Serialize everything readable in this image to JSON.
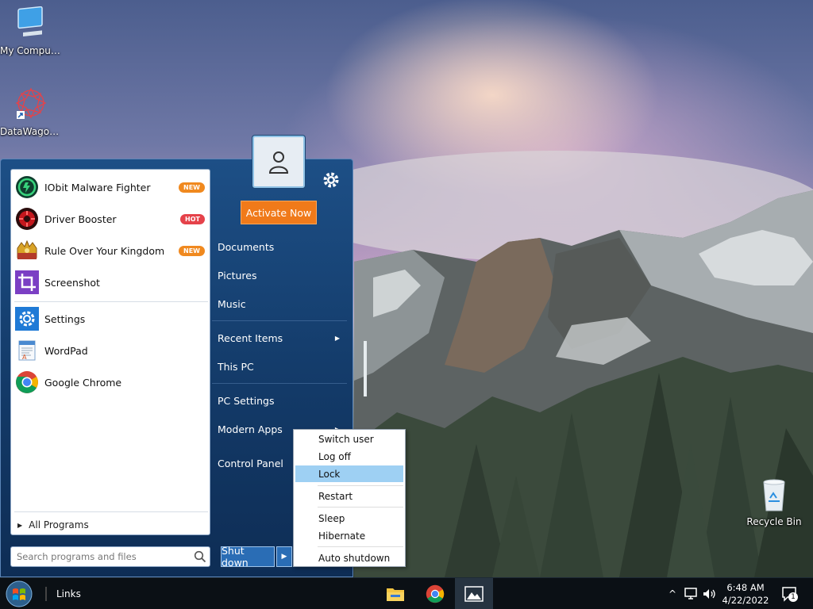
{
  "desktop": {
    "icons": [
      {
        "label": "My Computer",
        "icon": "computer-icon"
      },
      {
        "label": "DataWagon...",
        "icon": "datawagon-shortcut-icon"
      },
      {
        "label": "Recycle Bin",
        "icon": "recycle-bin-icon"
      }
    ]
  },
  "start_menu": {
    "programs": [
      {
        "name": "IObit Malware Fighter",
        "badge": "NEW",
        "badge_color": "#f0891f",
        "icon": "shield-icon"
      },
      {
        "name": "Driver Booster",
        "badge": "HOT",
        "badge_color": "#e5424a",
        "icon": "driver-booster-icon"
      },
      {
        "name": "Rule Over Your Kingdom",
        "badge": "NEW",
        "badge_color": "#f0891f",
        "icon": "kingdom-game-icon"
      },
      {
        "name": "Screenshot",
        "badge": "",
        "icon": "crop-icon"
      },
      {
        "name": "Settings",
        "badge": "",
        "icon": "gear-icon"
      },
      {
        "name": "WordPad",
        "badge": "",
        "icon": "wordpad-icon"
      },
      {
        "name": "Google Chrome",
        "badge": "",
        "icon": "chrome-icon"
      }
    ],
    "all_programs": "All Programs",
    "search_placeholder": "Search programs and files",
    "activate_label": "Activate Now",
    "right_items": [
      {
        "label": "Documents",
        "submenu": false
      },
      {
        "label": "Pictures",
        "submenu": false
      },
      {
        "label": "Music",
        "submenu": false
      },
      {
        "label": "Recent Items",
        "submenu": true
      },
      {
        "label": "This PC",
        "submenu": false
      },
      {
        "label": "PC Settings",
        "submenu": false
      },
      {
        "label": "Modern Apps",
        "submenu": true
      },
      {
        "label": "Control Panel",
        "submenu": false
      }
    ],
    "shutdown_label": "Shut down"
  },
  "shutdown_menu": {
    "items": [
      "Switch user",
      "Log off",
      "Lock",
      "Restart",
      "Sleep",
      "Hibernate",
      "Auto shutdown"
    ],
    "highlighted": "Lock"
  },
  "taskbar": {
    "links_label": "Links",
    "apps": [
      "file-explorer-icon",
      "chrome-icon",
      "photos-icon"
    ],
    "active_app": "photos-icon",
    "clock_time": "6:48 AM",
    "clock_date": "4/22/2022",
    "notification_count": "1"
  },
  "colors": {
    "accent_orange": "#f07a1a",
    "menu_blue": "#1d4f86",
    "highlight": "#9ed0f3"
  }
}
